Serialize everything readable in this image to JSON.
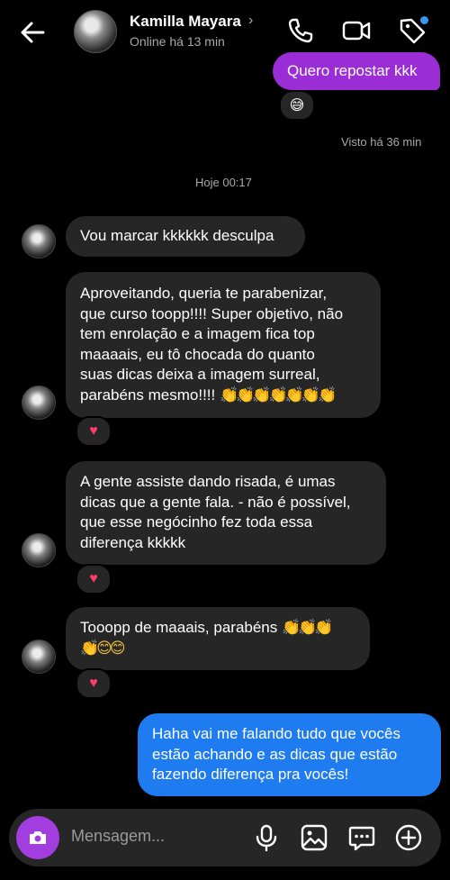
{
  "header": {
    "contact_name": "Kamilla Mayara",
    "status": "Online há 13 min",
    "chevron": "›"
  },
  "messages": {
    "top_out": "Quero repostar kkk",
    "top_reaction": "😅",
    "seen": "Visto há 36 min",
    "date_sep": "Hoje 00:17",
    "m1": "Vou marcar kkkkkk desculpa",
    "m2": {
      "l1": "Aproveitando, queria te parabenizar,",
      "l2": "que curso toopp!!!! Super objetivo, não",
      "l3": "tem enrolação e a imagem fica top",
      "l4": "maaaais, eu tô chocada do quanto",
      "l5": "suas dicas deixa a imagem surreal,",
      "l6": "parabéns mesmo!!!! ",
      "l6_emoji": "👏👏👏👏👏👏👏"
    },
    "m3": {
      "l1": "A gente assiste dando risada, é umas",
      "l2": "dicas que a gente fala. - não é possível,",
      "l3": "que esse negócinho fez toda essa",
      "l4": "diferença kkkkk"
    },
    "m4": {
      "l1": "Tooopp de maaais, parabéns ",
      "l1_emoji": "👏👏👏",
      "l2_emoji": "👏😊😊"
    },
    "out_blue": {
      "l1": "Haha vai me falando tudo que vocês",
      "l2": "estão achando e as dicas que estão",
      "l3": "fazendo diferença pra vocês!"
    },
    "heart": "♥"
  },
  "composer": {
    "placeholder": "Mensagem..."
  }
}
